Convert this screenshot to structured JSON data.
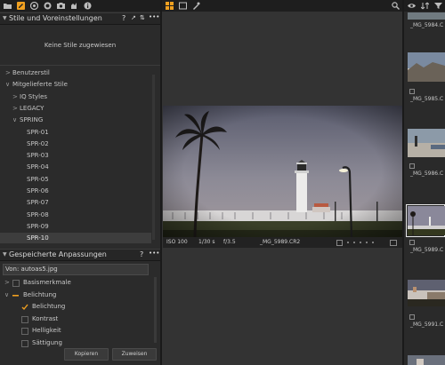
{
  "toolbar": {
    "left_icons": [
      "folder-icon",
      "edit-icon",
      "aperture-icon",
      "lens-icon",
      "camera-icon",
      "palette-icon",
      "info-icon"
    ],
    "mid_icons": [
      "grid-icon",
      "frame-icon",
      "eyedropper-icon"
    ]
  },
  "styles_panel": {
    "title": "Stile und Voreinstellungen",
    "help": "?",
    "more": "•••",
    "empty_text": "Keine Stile zugewiesen",
    "tree": [
      {
        "label": "Benutzerstil",
        "level": 0,
        "twisty": ">"
      },
      {
        "label": "Mitgelieferte Stile",
        "level": 0,
        "twisty": "∨"
      },
      {
        "label": "IQ Styles",
        "level": 1,
        "twisty": ">"
      },
      {
        "label": "LEGACY",
        "level": 1,
        "twisty": ">"
      },
      {
        "label": "SPRING",
        "level": 1,
        "twisty": "∨"
      },
      {
        "label": "SPR-01",
        "level": 2
      },
      {
        "label": "SPR-02",
        "level": 2
      },
      {
        "label": "SPR-03",
        "level": 2
      },
      {
        "label": "SPR-04",
        "level": 2
      },
      {
        "label": "SPR-05",
        "level": 2
      },
      {
        "label": "SPR-06",
        "level": 2
      },
      {
        "label": "SPR-07",
        "level": 2
      },
      {
        "label": "SPR-08",
        "level": 2
      },
      {
        "label": "SPR-09",
        "level": 2
      },
      {
        "label": "SPR-10",
        "level": 2,
        "selected": true
      }
    ]
  },
  "adjust_panel": {
    "title": "Gespeicherte Anpassungen",
    "help": "?",
    "more": "•••",
    "source_label": "Von: autoas5.jpg",
    "items": [
      {
        "label": "Basismerkmale",
        "checked": false,
        "twisty": ">"
      },
      {
        "label": "Belichtung",
        "checked": "partial",
        "twisty": "∨"
      },
      {
        "label": "Belichtung",
        "checked": true,
        "indent": true
      },
      {
        "label": "Kontrast",
        "checked": false,
        "indent": true
      },
      {
        "label": "Helligkeit",
        "checked": false,
        "indent": true
      },
      {
        "label": "Sättigung",
        "checked": false,
        "indent": true
      }
    ],
    "copy_button": "Kopieren",
    "apply_button": "Zuweisen"
  },
  "viewer": {
    "iso": "ISO 100",
    "shutter": "1/30 s",
    "aperture": "f/3.5",
    "filename": "_MG_5989.CR2"
  },
  "browser": {
    "thumbs": [
      {
        "caption": "_MG_5984.C"
      },
      {
        "caption": "_MG_5985.C"
      },
      {
        "caption": "_MG_5986.C"
      },
      {
        "caption": "_MG_5989.C",
        "selected": true
      },
      {
        "caption": "_MG_5991.C"
      }
    ]
  },
  "colors": {
    "accent": "#f0a020",
    "selection_border": "#e8e8e8",
    "panel_bg": "#2b2b2b"
  }
}
